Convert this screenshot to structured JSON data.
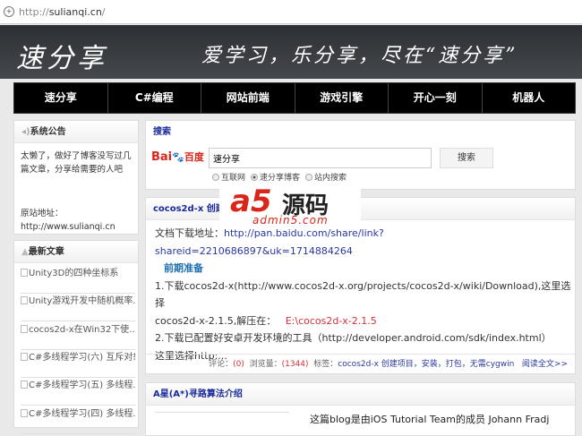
{
  "browser": {
    "url_prefix": "http://",
    "url_host": "sulianqi.cn",
    "url_suffix": "/"
  },
  "header": {
    "logo": "速分享",
    "slogan": "爱学习，乐分享，尽在“速分享”"
  },
  "nav": [
    "速分享",
    "C#编程",
    "网站前端",
    "游戏引擎",
    "开心一刻",
    "机器人"
  ],
  "notice": {
    "title": "系统公告",
    "text": "太懒了，做好了博客没写过几篇文章，分享给需要的人吧",
    "addr_label": "原站地址：",
    "addr": "http://www.sulianqi.cn"
  },
  "latest": {
    "title": "最新文章",
    "items": [
      "Unity3D的四种坐标系",
      "Unity游戏开发中随机概率...",
      "cocos2d-x在Win32下使...",
      "C#多线程学习(六) 互斥对象",
      "C#多线程学习(五) 多线程...",
      "C#多线程学习(四) 多线程..."
    ]
  },
  "search": {
    "title": "搜索",
    "baidu": "Bai",
    "baidu_cn": "百度",
    "value": "速分享",
    "button": "搜索",
    "radios": [
      "互联网",
      "速分享博客",
      "站内搜索"
    ],
    "selected": 1
  },
  "article": {
    "title": "cocos2d-x 创建",
    "dl_label": "文档下载地址：",
    "dl_link": "http://pan.baidu.com/share/link?shareid=2210686897&uk=1714884264",
    "sub": "前期准备",
    "l1": "1.下载cocos2d-x(http://www.cocos2d-x.org/projects/cocos2d-x/wiki/Download),这里选择",
    "l2a": "cocos2d-x-2.1.5,解压在：",
    "l2b": "E:\\cocos2d-x-2.1.5",
    "l3": "2.下载已配置好安卓开发环境的工具（http://developer.android.com/sdk/index.html）",
    "l4": "这里选择http:...",
    "comments_label": "评论：",
    "comments": "(0)",
    "views_label": "浏览量：",
    "views": "(1344)",
    "tags_label": "标签：",
    "tags": "cocos2d-x 创建项目，安装，打包，无需cygwin",
    "read_more": "阅读全文>>"
  },
  "article2": {
    "title": "A星(A*)寻路算法介绍",
    "text": "这篇blog是由iOS Tutorial Team的成员  Johann Fradj"
  },
  "watermark": {
    "brand": "a5",
    "name": "源码",
    "domain": "admin5.com"
  }
}
